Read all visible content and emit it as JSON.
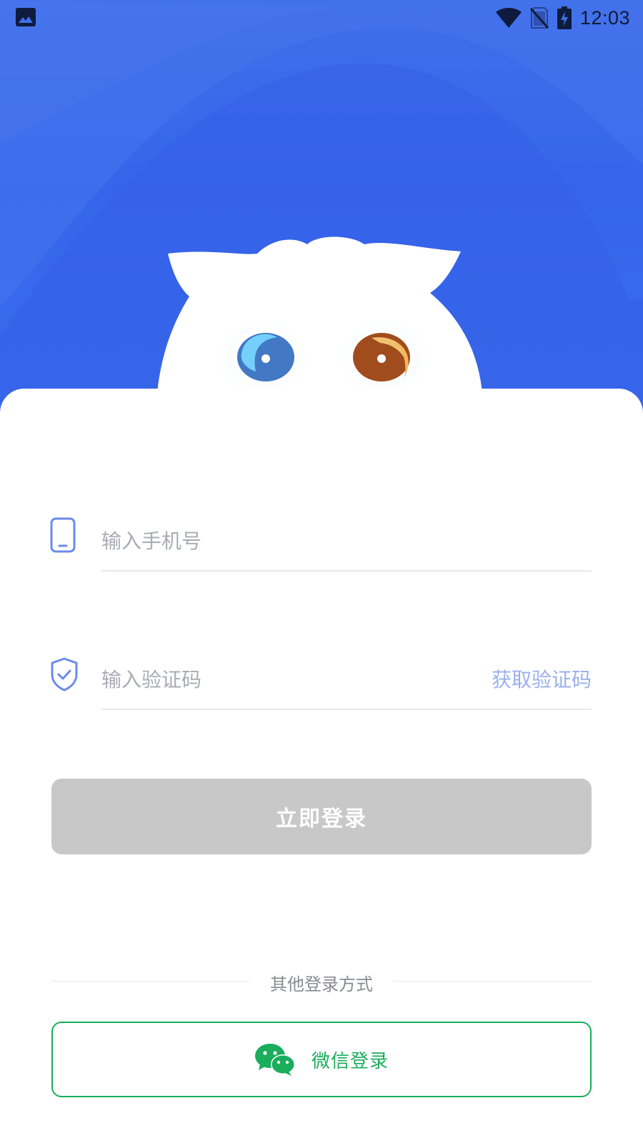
{
  "status_bar": {
    "time": "12:03",
    "left_icon": "gallery-icon",
    "right_icons": [
      "wifi-icon",
      "no-sim-icon",
      "battery-charging-icon"
    ]
  },
  "hero": {
    "background_color": "#3766ea",
    "mascot": "owl-mascot"
  },
  "form": {
    "phone": {
      "icon": "phone-icon",
      "placeholder": "输入手机号",
      "value": ""
    },
    "code": {
      "icon": "shield-check-icon",
      "placeholder": "输入验证码",
      "value": "",
      "get_code_label": "获取验证码"
    },
    "login_button": "立即登录"
  },
  "other_login": {
    "divider_text": "其他登录方式",
    "wechat_button": "微信登录",
    "wechat_icon": "wechat-icon"
  },
  "colors": {
    "accent": "#3766ea",
    "disabled_button": "#c8c8c8",
    "wechat_green": "#1aad5b",
    "link": "#9ab0ec"
  }
}
